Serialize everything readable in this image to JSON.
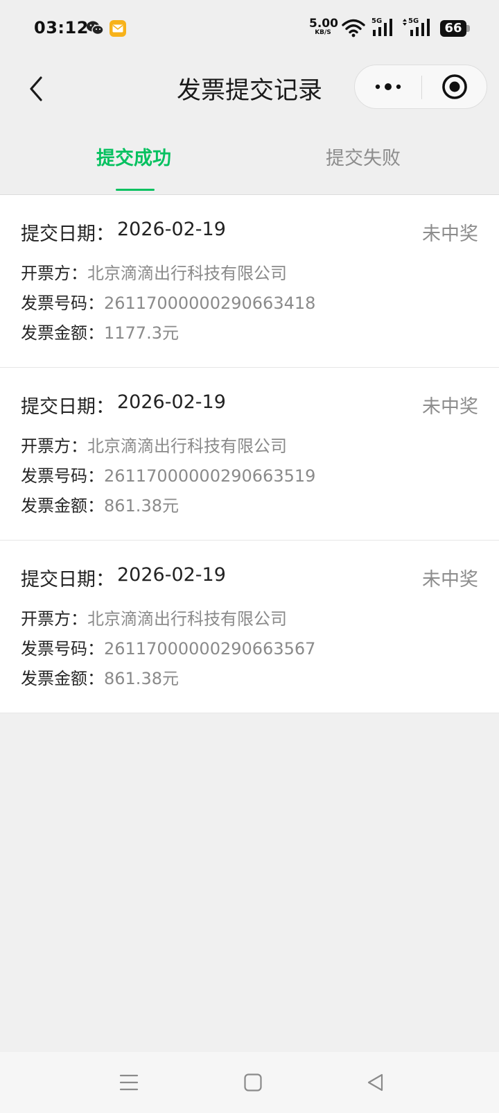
{
  "status_bar": {
    "time": "03:12",
    "net_speed_value": "5.00",
    "net_speed_unit": "KB/S",
    "sim1_label": "5G",
    "sim2_label": "5G",
    "battery_level": "66",
    "icons": [
      "wechat-icon",
      "message-icon",
      "wifi-icon",
      "signal-icon",
      "battery-icon"
    ]
  },
  "nav": {
    "title": "发票提交记录"
  },
  "tabs": [
    {
      "label": "提交成功",
      "active": true
    },
    {
      "label": "提交失败",
      "active": false
    }
  ],
  "accent_color": "#07c160",
  "records": [
    {
      "date_label": "提交日期：",
      "date": "2026-02-19",
      "status": "未中奖",
      "issuer_label": "开票方：",
      "issuer": "北京滴滴出行科技有限公司",
      "number_label": "发票号码：",
      "number": "26117000000290663418",
      "amount_label": "发票金额：",
      "amount": "1177.3元"
    },
    {
      "date_label": "提交日期：",
      "date": "2026-02-19",
      "status": "未中奖",
      "issuer_label": "开票方：",
      "issuer": "北京滴滴出行科技有限公司",
      "number_label": "发票号码：",
      "number": "26117000000290663519",
      "amount_label": "发票金额：",
      "amount": "861.38元"
    },
    {
      "date_label": "提交日期：",
      "date": "2026-02-19",
      "status": "未中奖",
      "issuer_label": "开票方：",
      "issuer": "北京滴滴出行科技有限公司",
      "number_label": "发票号码：",
      "number": "26117000000290663567",
      "amount_label": "发票金额：",
      "amount": "861.38元"
    }
  ]
}
